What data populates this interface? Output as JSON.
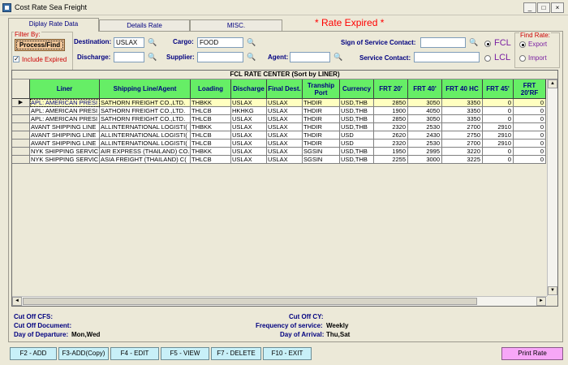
{
  "window": {
    "title": "Cost Rate Sea Freight",
    "buttons": [
      "_",
      "□",
      "×"
    ]
  },
  "tabs": [
    {
      "label": "Diplay Rate Data",
      "active": true
    },
    {
      "label": "Details Rate",
      "active": false
    },
    {
      "label": "MISC.",
      "active": false
    }
  ],
  "status": {
    "rate_expired": "* Rate Expired *"
  },
  "filter": {
    "title": "Filter By:",
    "process_label": "Process/Find",
    "include_expired_label": "Include Expired",
    "include_expired_checked": true,
    "destination_label": "Destination:",
    "destination_value": "USLAX",
    "discharge_label": "Discharge:",
    "discharge_value": "",
    "cargo_label": "Cargo:",
    "cargo_value": "FOOD",
    "supplier_label": "Supplier:",
    "supplier_value": "",
    "agent_label": "Agent:",
    "agent_value": "",
    "sign_label": "Sign of Service Contact:",
    "sign_value": "",
    "service_contact_label": "Service Contact:",
    "service_contact_value": "",
    "fcl_label": "FCL",
    "lcl_label": "LCL",
    "fcl_selected": true,
    "find_rate_title": "Find Rate:",
    "export_label": "Export",
    "import_label": "Import",
    "export_selected": true
  },
  "grid": {
    "caption": "FCL RATE CENTER (Sort by LINER)",
    "columns": [
      "Liner",
      "Shipping Line/Agent",
      "Loading",
      "Discharge",
      "Final Dest.",
      "Tranship Port",
      "Currency",
      "FRT 20'",
      "FRT 40'",
      "FRT 40 HC",
      "FRT 45'",
      "FRT 20'RF"
    ],
    "rows": [
      {
        "liner": "APL: AMERICAN PRESI",
        "agent": "SATHORN FREIGHT CO.,LTD.",
        "loading": "THBKK",
        "discharge": "USLAX",
        "final": "USLAX",
        "tranship": "THDIR",
        "currency": "USD,THB",
        "f20": "2850",
        "f40": "3050",
        "f40hc": "3350",
        "f45": "0",
        "f20rf": "0",
        "selected": true
      },
      {
        "liner": "APL: AMERICAN PRESI",
        "agent": "SATHORN FREIGHT CO.,LTD.",
        "loading": "THLCB",
        "discharge": "HKHKG",
        "final": "USLAX",
        "tranship": "THDIR",
        "currency": "USD,THB",
        "f20": "1900",
        "f40": "4050",
        "f40hc": "3350",
        "f45": "0",
        "f20rf": "0",
        "selected": false
      },
      {
        "liner": "APL: AMERICAN PRESI",
        "agent": "SATHORN FREIGHT CO.,LTD.",
        "loading": "THLCB",
        "discharge": "USLAX",
        "final": "USLAX",
        "tranship": "THDIR",
        "currency": "USD,THB",
        "f20": "2850",
        "f40": "3050",
        "f40hc": "3350",
        "f45": "0",
        "f20rf": "0",
        "selected": false
      },
      {
        "liner": "AVANT SHIPPING LINE",
        "agent": "ALLINTERNATIONAL LOGISTI(",
        "loading": "THBKK",
        "discharge": "USLAX",
        "final": "USLAX",
        "tranship": "THDIR",
        "currency": "USD,THB",
        "f20": "2320",
        "f40": "2530",
        "f40hc": "2700",
        "f45": "2910",
        "f20rf": "0",
        "selected": false
      },
      {
        "liner": "AVANT SHIPPING LINE",
        "agent": "ALLINTERNATIONAL LOGISTI(",
        "loading": "THLCB",
        "discharge": "USLAX",
        "final": "USLAX",
        "tranship": "THDIR",
        "currency": "USD",
        "f20": "2620",
        "f40": "2430",
        "f40hc": "2750",
        "f45": "2910",
        "f20rf": "0",
        "selected": false
      },
      {
        "liner": "AVANT SHIPPING LINE",
        "agent": "ALLINTERNATIONAL LOGISTI(",
        "loading": "THLCB",
        "discharge": "USLAX",
        "final": "USLAX",
        "tranship": "THDIR",
        "currency": "USD",
        "f20": "2320",
        "f40": "2530",
        "f40hc": "2700",
        "f45": "2910",
        "f20rf": "0",
        "selected": false
      },
      {
        "liner": "NYK SHIPPING SERVIC",
        "agent": "AIR EXPRESS (THAILAND) CO.",
        "loading": "THBKK",
        "discharge": "USLAX",
        "final": "USLAX",
        "tranship": "SGSIN",
        "currency": "USD,THB",
        "f20": "1950",
        "f40": "2995",
        "f40hc": "3220",
        "f45": "0",
        "f20rf": "0",
        "selected": false
      },
      {
        "liner": "NYK SHIPPING SERVIC",
        "agent": "ASIA  FREIGHT (THAILAND) C(",
        "loading": "THLCB",
        "discharge": "USLAX",
        "final": "USLAX",
        "tranship": "SGSIN",
        "currency": "USD,THB",
        "f20": "2255",
        "f40": "3000",
        "f40hc": "3225",
        "f45": "0",
        "f20rf": "0",
        "selected": false
      }
    ]
  },
  "info": {
    "cut_off_cfs_label": "Cut Off CFS:",
    "cut_off_cfs_value": "",
    "cut_off_doc_label": "Cut Off Document:",
    "cut_off_doc_value": "",
    "departure_label": "Day of Departure:",
    "departure_value": "Mon,Wed",
    "cut_off_cy_label": "Cut Off CY:",
    "cut_off_cy_value": "",
    "frequency_label": "Frequency of service:",
    "frequency_value": "Weekly",
    "arrival_label": "Day of Arrival:",
    "arrival_value": "Thu,Sat"
  },
  "footer": {
    "buttons": [
      "F2 - ADD",
      "F3-ADD(Copy)",
      "F4 - EDIT",
      "F5 - VIEW",
      "F7 - DELETE",
      "F10 - EXIT"
    ],
    "print_label": "Print Rate"
  },
  "colors": {
    "header_green": "#66EE66",
    "expired_red": "#FF0000",
    "print_pink": "#F7A7F7",
    "fbutton_cyan": "#C8F0F8"
  }
}
